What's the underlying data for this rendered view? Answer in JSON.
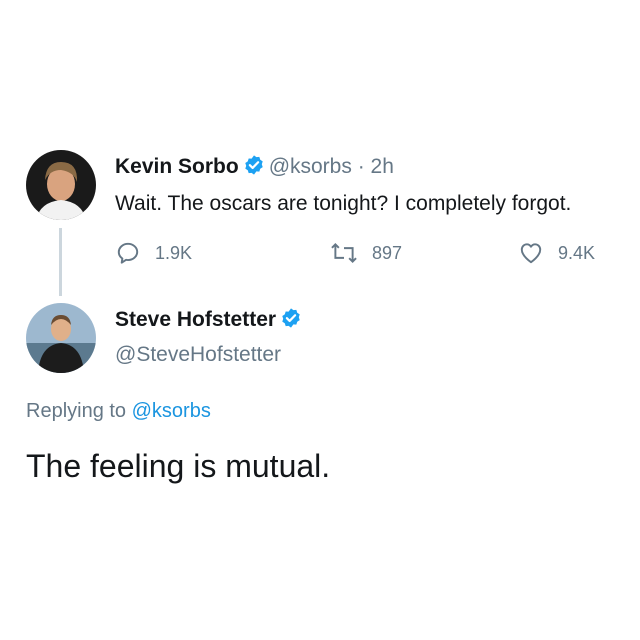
{
  "original_tweet": {
    "author_name": "Kevin Sorbo",
    "handle": "@ksorbs",
    "separator": "·",
    "time": "2h",
    "text": "Wait. The oscars are tonight? I completely forgot.",
    "stats": {
      "replies": "1.9K",
      "retweets": "897",
      "likes": "9.4K"
    },
    "verified": true,
    "avatar_icon": "person-avatar"
  },
  "reply_tweet": {
    "author_name": "Steve Hofstetter",
    "handle": "@SteveHofstetter",
    "verified": true,
    "avatar_icon": "person-avatar",
    "replying_prefix": "Replying to",
    "replying_to": "@ksorbs",
    "text": "The feeling is mutual."
  },
  "icons": {
    "reply": "reply-icon",
    "retweet": "retweet-icon",
    "like": "heart-icon",
    "verified": "verified-badge-icon"
  },
  "colors": {
    "verified_blue": "#1da1f2",
    "mention_blue": "#1b95e0",
    "secondary_text": "#657786",
    "thread_line": "#ccd6dd"
  }
}
